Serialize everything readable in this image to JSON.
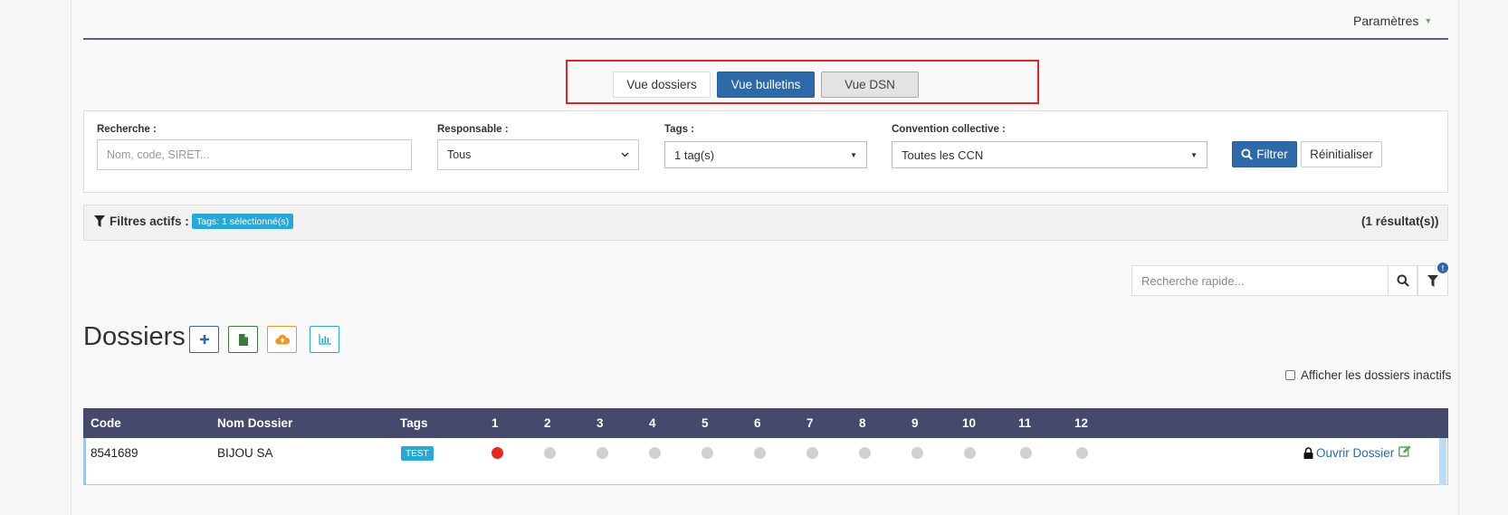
{
  "header": {
    "settings_label": "Paramètres"
  },
  "views": {
    "folders": "Vue dossiers",
    "payslips": "Vue bulletins",
    "dsn": "Vue DSN",
    "active": "Vue bulletins"
  },
  "filters": {
    "search_label": "Recherche :",
    "search_placeholder": "Nom, code, SIRET...",
    "manager_label": "Responsable :",
    "manager_value": "Tous",
    "tags_label": "Tags :",
    "tags_value": "1 tag(s)",
    "ccn_label": "Convention collective :",
    "ccn_value": "Toutes les CCN",
    "filter_button": "Filtrer",
    "reset_button": "Réinitialiser"
  },
  "active_filters": {
    "label": "Filtres actifs :",
    "badge": "Tags: 1 sélectionné(s)",
    "result_count": "(1 résultat(s))"
  },
  "quick_search": {
    "placeholder": "Recherche rapide...",
    "notification": "!"
  },
  "section": {
    "title": "Dossiers",
    "inactive_label": "Afficher les dossiers inactifs"
  },
  "table": {
    "headers": {
      "code": "Code",
      "name": "Nom Dossier",
      "tags": "Tags"
    },
    "months": [
      "1",
      "2",
      "3",
      "4",
      "5",
      "6",
      "7",
      "8",
      "9",
      "10",
      "11",
      "12"
    ],
    "rows": [
      {
        "code": "8541689",
        "name": "BIJOU SA",
        "tag": "TEST",
        "open_label": "Ouvrir Dossier",
        "month_status": [
          "red",
          "grey",
          "grey",
          "grey",
          "grey",
          "grey",
          "grey",
          "grey",
          "grey",
          "grey",
          "grey",
          "grey"
        ]
      }
    ]
  },
  "colors": {
    "primary": "#2e6aa7",
    "header_bg": "#454a6c",
    "badge": "#29a8d6",
    "alert": "#e8281e",
    "highlight_box": "#e0242a"
  }
}
